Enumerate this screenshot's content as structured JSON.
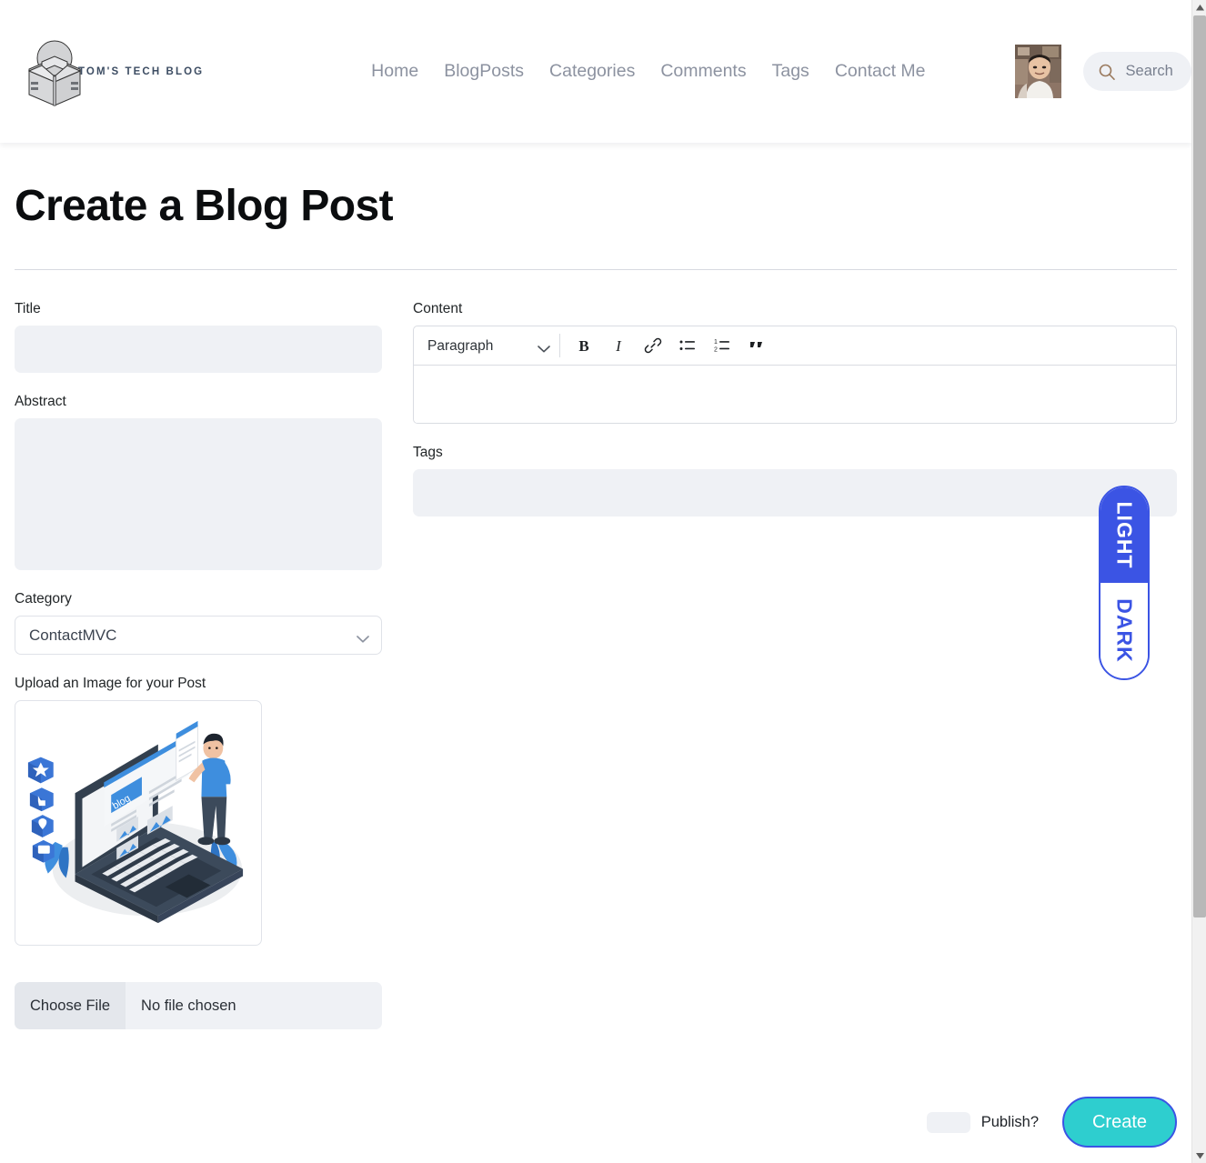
{
  "header": {
    "brand_text": "TOM'S TECH BLOG",
    "logo_icon": "book-reader-logo-icon",
    "nav": [
      {
        "label": "Home",
        "name": "nav-link-home"
      },
      {
        "label": "BlogPosts",
        "name": "nav-link-blogposts"
      },
      {
        "label": "Categories",
        "name": "nav-link-categories"
      },
      {
        "label": "Comments",
        "name": "nav-link-comments"
      },
      {
        "label": "Tags",
        "name": "nav-link-tags"
      },
      {
        "label": "Contact Me",
        "name": "nav-link-contact-me"
      }
    ],
    "avatar_alt": "user-avatar",
    "search": {
      "icon": "search-icon",
      "placeholder": "Search",
      "value": ""
    }
  },
  "main": {
    "page_title": "Create a Blog Post",
    "fields": {
      "title": {
        "label": "Title",
        "value": "",
        "placeholder": ""
      },
      "abstract": {
        "label": "Abstract",
        "value": "",
        "placeholder": ""
      },
      "category": {
        "label": "Category",
        "selected": "ContactMVC",
        "options": [
          "ContactMVC"
        ],
        "chevron_icon": "chevron-down-icon"
      },
      "upload": {
        "label": "Upload an Image for your Post",
        "preview_alt": "blog-post-illustration",
        "choose_file_label": "Choose File",
        "file_status": "No file chosen"
      },
      "content": {
        "label": "Content",
        "value": ""
      },
      "tags": {
        "label": "Tags",
        "value": "",
        "placeholder": ""
      }
    },
    "editor_toolbar": {
      "block_format": {
        "selected": "Paragraph",
        "options": [
          "Paragraph"
        ],
        "chevron_icon": "chevron-down-icon"
      },
      "buttons": [
        {
          "name": "bold-icon",
          "title": "Bold"
        },
        {
          "name": "italic-icon",
          "title": "Italic"
        },
        {
          "name": "link-icon",
          "title": "Link"
        },
        {
          "name": "bullet-list-icon",
          "title": "Bulleted list"
        },
        {
          "name": "numbered-list-icon",
          "title": "Numbered list"
        },
        {
          "name": "blockquote-icon",
          "title": "Blockquote"
        }
      ]
    }
  },
  "theme_toggle": {
    "light_label": "LIGHT",
    "dark_label": "DARK",
    "active": "LIGHT"
  },
  "actions": {
    "publish_label": "Publish?",
    "publish_checked": false,
    "create_label": "Create"
  },
  "colors": {
    "accent_blue": "#3b54e4",
    "create_teal": "#2ececf",
    "input_bg": "#eff1f5",
    "nav_text": "#8c92a0",
    "brand_text": "#3d4d63"
  },
  "scrollbar": {
    "up_icon": "scroll-up-arrow-icon",
    "down_icon": "scroll-down-arrow-icon"
  }
}
